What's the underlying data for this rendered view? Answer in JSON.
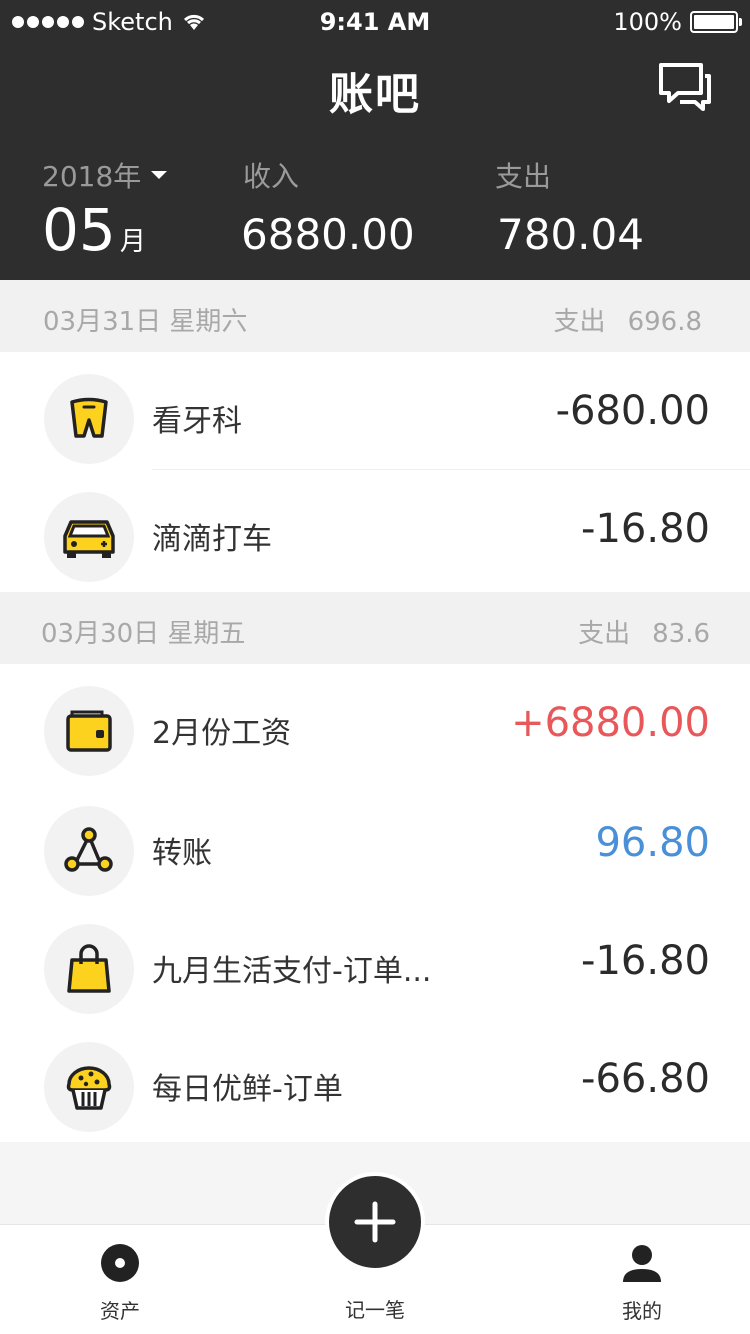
{
  "status_bar": {
    "carrier": "Sketch",
    "time": "9:41 AM",
    "battery": "100%"
  },
  "header": {
    "title": "账吧",
    "year": "2018年",
    "month": "05",
    "month_unit": "月",
    "income_label": "收入",
    "income_value": "6880.00",
    "expense_label": "支出",
    "expense_value": "780.04"
  },
  "days": [
    {
      "date": "03月31日 星期六",
      "sum_label": "支出",
      "sum_value": "696.8",
      "items": [
        {
          "title": "看牙科",
          "amount": "-680.00",
          "icon": "tooth-icon",
          "color": "#2b2b2b"
        },
        {
          "title": "滴滴打车",
          "amount": "-16.80",
          "icon": "car-icon",
          "color": "#2b2b2b"
        }
      ]
    },
    {
      "date": "03月30日 星期五",
      "sum_label": "支出",
      "sum_value": "83.6",
      "items": [
        {
          "title": "2月份工资",
          "amount": "+6880.00",
          "icon": "wallet-icon",
          "color": "#e8585a"
        },
        {
          "title": "转账",
          "amount": "96.80",
          "icon": "transfer-icon",
          "color": "#4a90d9"
        },
        {
          "title": "九月生活支付-订单...",
          "amount": "-16.80",
          "icon": "shopping-bag-icon",
          "color": "#2b2b2b"
        },
        {
          "title": "每日优鲜-订单",
          "amount": "-66.80",
          "icon": "cupcake-icon",
          "color": "#2b2b2b"
        }
      ]
    }
  ],
  "tabbar": {
    "assets_label": "资产",
    "add_label": "记一笔",
    "me_label": "我的"
  },
  "colors": {
    "header_bg": "#2e2e2e",
    "accent_yellow": "#fcd21f",
    "income_red": "#e8585a",
    "transfer_blue": "#4a90d9"
  }
}
